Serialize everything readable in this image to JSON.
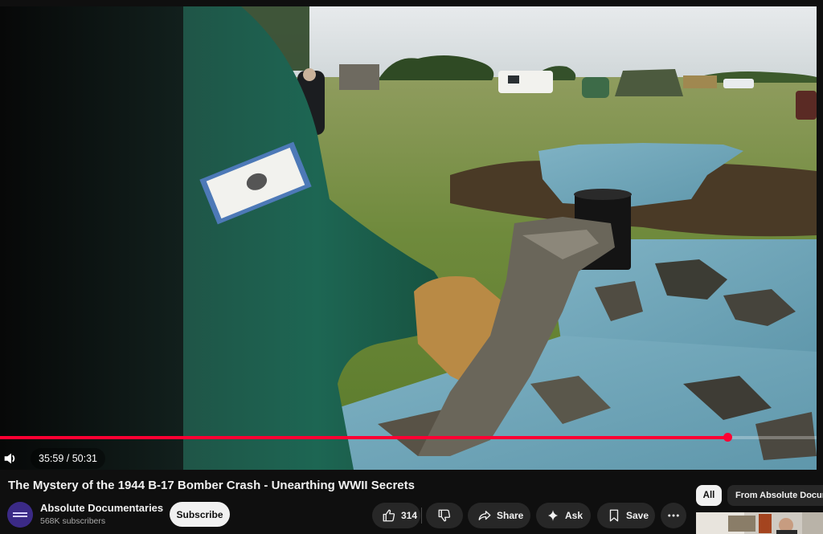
{
  "player": {
    "current_time": "35:59",
    "duration": "50:31",
    "time_display": "35:59 / 50:31",
    "progress_fraction": 0.8903
  },
  "video": {
    "title": "The Mystery of the 1944 B-17 Bomber Crash - Unearthing WWII Secrets"
  },
  "channel": {
    "name": "Absolute Documentaries",
    "subscribers": "568K subscribers",
    "subscribe_label": "Subscribe"
  },
  "actions": {
    "like_count": "314",
    "share_label": "Share",
    "ask_label": "Ask",
    "save_label": "Save"
  },
  "filters": {
    "all_label": "All",
    "from_channel_label": "From Absolute Docum"
  },
  "colors": {
    "background": "#0f0f0f",
    "progress": "#ff0033",
    "pill": "#272727",
    "text": "#f1f1f1",
    "secondary_text": "#aaaaaa"
  },
  "icons": [
    "volume-icon",
    "thumb-up-icon",
    "thumb-down-icon",
    "share-icon",
    "sparkle-icon",
    "bookmark-icon",
    "more-icon"
  ]
}
